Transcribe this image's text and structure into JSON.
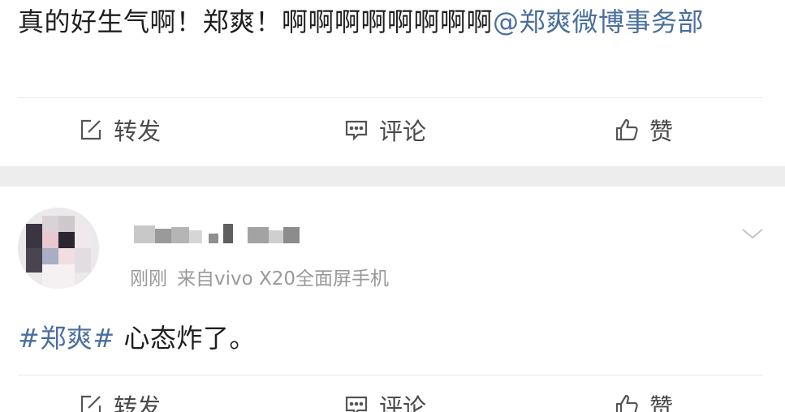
{
  "post_1": {
    "text": "真的好生气啊！郑爽！啊啊啊啊啊啊啊啊",
    "mention": "@郑爽微博事务部"
  },
  "post_2": {
    "timestamp": "刚刚",
    "source": "来自vivo X20全面屏手机",
    "hashtag": "#郑爽#",
    "text": " 心态炸了。"
  },
  "actions": {
    "repost": "转发",
    "comment": "评论",
    "like": "赞"
  },
  "icons": {
    "repost": "edit-square-icon",
    "comment": "comment-bubble-icon",
    "like": "thumbs-up-icon",
    "menu": "chevron-down-icon"
  },
  "colors": {
    "link": "#4a6f9e",
    "meta": "#999999",
    "separator": "#ededed"
  }
}
